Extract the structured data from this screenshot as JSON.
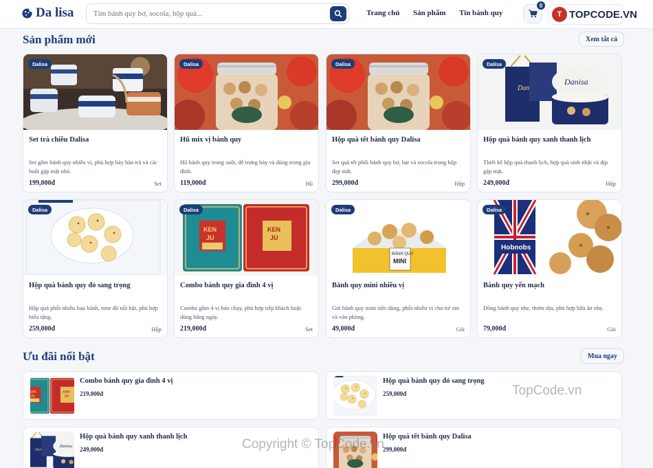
{
  "header": {
    "logo": "Da lisa",
    "search_placeholder": "Tìm bánh quy bơ, socola, hộp quà...",
    "nav": [
      "Trang chủ",
      "Sản phẩm",
      "Tin bánh quy"
    ],
    "cart_count": "0",
    "brand_watermark": "TOPCODE.VN",
    "brand_mark": "T"
  },
  "new_products": {
    "title": "Sản phẩm mới",
    "view_all": "Xem tất cả",
    "items": [
      {
        "tag": "Dalisa",
        "name": "Set trà chiều Dalisa",
        "desc": "Set gồm bánh quy nhiều vị, phù hợp bày bàn trà và các buổi gặp mặt nhỏ.",
        "price": "199,000đ",
        "unit": "Set",
        "image": "tea-set"
      },
      {
        "tag": "Dalisa",
        "name": "Hũ mix vị bánh quy",
        "desc": "Hũ bánh quy trong suốt, dễ trưng bày và dùng trong gia đình.",
        "price": "119,000đ",
        "unit": "Hũ",
        "image": "cookie-jar"
      },
      {
        "tag": "Dalisa",
        "name": "Hộp quà tết bánh quy Dalisa",
        "desc": "Set quà tết phối bánh quy bơ, hạt và socola trong hộp đẹp mắt.",
        "price": "299,000đ",
        "unit": "Hộp",
        "image": "cookie-jar"
      },
      {
        "tag": "Dalisa",
        "name": "Hộp quà bánh quy xanh thanh lịch",
        "desc": "Thiết kế hộp quà thanh lịch, hợp quà sinh nhật và dịp gặp mặt.",
        "price": "249,000đ",
        "unit": "Hộp",
        "image": "blue-tin"
      },
      {
        "tag": "Dalisa",
        "name": "Hộp quà bánh quy đỏ sang trọng",
        "desc": "Hộp quà phối nhiều loại bánh, tone đỏ nổi bật, phù hợp biếu tặng.",
        "price": "259,000đ",
        "unit": "Hộp",
        "image": "plate-cookies"
      },
      {
        "tag": "Dalisa",
        "name": "Combo bánh quy gia đình 4 vị",
        "desc": "Combo gồm 4 vị bán chạy, phù hợp tiếp khách hoặc dùng hằng ngày.",
        "price": "219,000đ",
        "unit": "Set",
        "image": "kenju-tins"
      },
      {
        "tag": "Dalisa",
        "name": "Bánh quy mini nhiều vị",
        "desc": "Gói bánh quy mini tiện dùng, phối nhiều vị cho trẻ em và văn phòng.",
        "price": "49,000đ",
        "unit": "Gói",
        "image": "mini-pack"
      },
      {
        "tag": "Dalisa",
        "name": "Bánh quy yến mạch",
        "desc": "Dòng bánh quy nhẹ, thơm dịu, phù hợp bữa ăn nhẹ.",
        "price": "79,000đ",
        "unit": "Gói",
        "image": "hobnobs"
      }
    ]
  },
  "offers": {
    "title": "Ưu đãi nổi bật",
    "button": "Mua ngay",
    "items": [
      {
        "name": "Combo bánh quy gia đình 4 vị",
        "price": "219,000đ",
        "image": "kenju-tins"
      },
      {
        "name": "Hộp quà bánh quy đỏ sang trọng",
        "price": "259,000đ",
        "image": "plate-cookies"
      },
      {
        "name": "Hộp quà bánh quy xanh thanh lịch",
        "price": "249,000đ",
        "image": "blue-tin"
      },
      {
        "name": "Hộp quà tết bánh quy Dalisa",
        "price": "299,000đ",
        "image": "cookie-jar"
      }
    ]
  },
  "watermarks": {
    "center": "TopCode.vn",
    "bottom": "Copyright © TopCode.vn"
  },
  "colors": {
    "primary": "#1d3c78",
    "background": "#f4f6f9",
    "card": "#ffffff"
  }
}
